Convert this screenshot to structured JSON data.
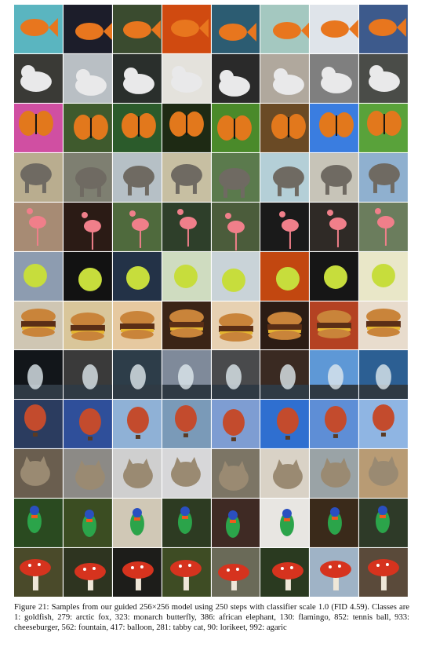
{
  "figure": {
    "caption": "Figure 21: Samples from our guided 256×256 model using 250 steps with classifier scale 1.0 (FID 4.59). Classes are 1: goldfish, 279: arctic fox, 323: monarch butterfly, 386: african elephant, 130: flamingo, 852: tennis ball, 933: cheeseburger, 562: fountain, 417: balloon, 281: tabby cat, 90: lorikeet, 992: agaric",
    "rows": [
      {
        "cls": "goldfish",
        "bg": "#3f5d64",
        "subject": "#e8761e",
        "shape": "fish",
        "bgs": [
          "#5ab5c0",
          "#1c1d2a",
          "#3a4b2f",
          "#d04a10",
          "#2c5c72",
          "#a4c8c0",
          "#dfe4ea",
          "#3d5a8c"
        ]
      },
      {
        "cls": "arctic fox",
        "bg": "#2b2b2b",
        "subject": "#e9e9ea",
        "shape": "fox",
        "bgs": [
          "#3a3a36",
          "#b9bfc4",
          "#2a2f2c",
          "#e4e2dc",
          "#2a2a2a",
          "#b0a89d",
          "#7f7f7f",
          "#4a4c48"
        ]
      },
      {
        "cls": "monarch butterfly",
        "bg": "#3a7d2e",
        "subject": "#e2781c",
        "shape": "butterfly",
        "bgs": [
          "#d04fa2",
          "#3f5a2d",
          "#2b5b2b",
          "#1e2a14",
          "#4a8a2a",
          "#6a4a25",
          "#3a7de0",
          "#59a23a"
        ]
      },
      {
        "cls": "african elephant",
        "bg": "#8e8c7a",
        "subject": "#6f6a62",
        "shape": "elephant",
        "bgs": [
          "#b9ad8f",
          "#7e7f71",
          "#b6c0c6",
          "#c7bfa2",
          "#5b7a4d",
          "#b4cfd7",
          "#c7c4b8",
          "#8fb0cf"
        ]
      },
      {
        "cls": "flamingo",
        "bg": "#6c7a58",
        "subject": "#f07f8a",
        "shape": "flamingo",
        "bgs": [
          "#a78b74",
          "#2b1b15",
          "#4f6a3d",
          "#2e3f2a",
          "#4b5c3b",
          "#1a1a1a",
          "#2f2a26",
          "#6b7d5d"
        ]
      },
      {
        "cls": "tennis ball",
        "bg": "#7c8aa0",
        "subject": "#c7dd3c",
        "shape": "ball",
        "bgs": [
          "#8d9cb0",
          "#121212",
          "#233247",
          "#cfdcc0",
          "#c9d3d8",
          "#c24710",
          "#161616",
          "#e9e7c8"
        ]
      },
      {
        "cls": "cheeseburger",
        "bg": "#c8ad84",
        "subject": "#b8742a",
        "shape": "burger",
        "bgs": [
          "#cfc6b3",
          "#d9c69a",
          "#e6c9a0",
          "#3b2416",
          "#e7d1b2",
          "#2b1c14",
          "#b44222",
          "#e8dccd"
        ]
      },
      {
        "cls": "fountain",
        "bg": "#1e2a3c",
        "subject": "#dfe8ee",
        "shape": "fountain",
        "bgs": [
          "#12161a",
          "#3a3a3a",
          "#2d3d49",
          "#7f8a9a",
          "#494a4c",
          "#3a2a22",
          "#5e98d6",
          "#2c5f93"
        ]
      },
      {
        "cls": "balloon",
        "bg": "#4d6fa8",
        "subject": "#c34b2d",
        "shape": "balloon",
        "bgs": [
          "#2b3c5f",
          "#2f4f9a",
          "#8fb1d6",
          "#7a9ab8",
          "#7e9dd2",
          "#2f6fd0",
          "#5e8ed6",
          "#8fb5e3"
        ]
      },
      {
        "cls": "tabby cat",
        "bg": "#7a6d5c",
        "subject": "#9a8a72",
        "shape": "cat",
        "bgs": [
          "#6a5e4f",
          "#8c8a86",
          "#cfcfcf",
          "#d7d7d9",
          "#7c7565",
          "#d9d2c6",
          "#9aa3a6",
          "#b89b74"
        ]
      },
      {
        "cls": "lorikeet",
        "bg": "#3d5a2f",
        "subject": "#2ba44a",
        "shape": "bird",
        "bgs": [
          "#2a4a20",
          "#3b4d22",
          "#d0c8b6",
          "#2d3b22",
          "#3f2a24",
          "#e8e6e2",
          "#3a2a1a",
          "#2e3a28"
        ]
      },
      {
        "cls": "agaric",
        "bg": "#3b3a22",
        "subject": "#d6331e",
        "shape": "mushroom",
        "bgs": [
          "#4a4a2a",
          "#2e3420",
          "#1d1d1a",
          "#3e4c24",
          "#6a6a58",
          "#2a3a20",
          "#9fb3c6",
          "#5a4a3a"
        ]
      }
    ]
  }
}
